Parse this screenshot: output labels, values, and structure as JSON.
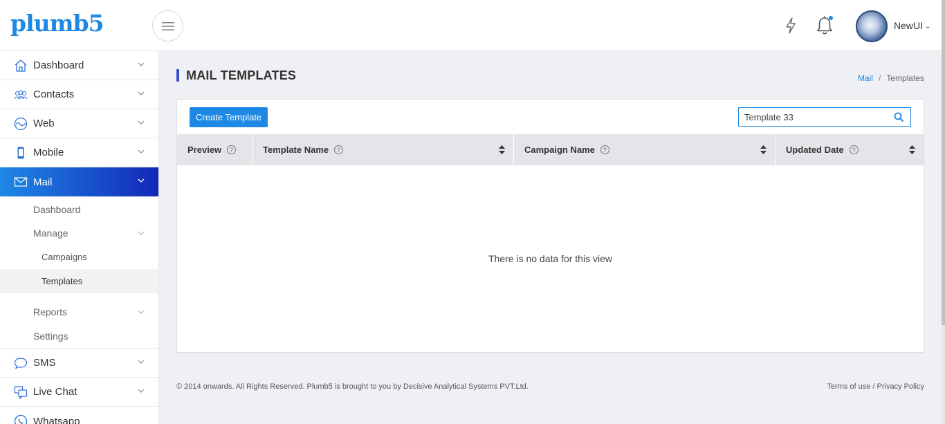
{
  "header": {
    "logo": "plumb5",
    "user_name": "NewUI",
    "menu_icon": "hamburger-icon",
    "bolt_icon": "lightning-icon",
    "bell_icon": "bell-icon",
    "accent": "#1e88e5"
  },
  "sidebar": {
    "items": [
      {
        "label": "Dashboard",
        "icon": "home-icon"
      },
      {
        "label": "Contacts",
        "icon": "contacts-icon"
      },
      {
        "label": "Web",
        "icon": "web-icon"
      },
      {
        "label": "Mobile",
        "icon": "mobile-icon"
      },
      {
        "label": "Mail",
        "icon": "mail-icon",
        "active": true
      },
      {
        "label": "SMS",
        "icon": "sms-icon"
      },
      {
        "label": "Live Chat",
        "icon": "live-chat-icon"
      },
      {
        "label": "Whatsapp",
        "icon": "whatsapp-icon"
      }
    ],
    "mail_sub": {
      "dashboard": "Dashboard",
      "manage": "Manage",
      "campaigns": "Campaigns",
      "templates": "Templates",
      "reports": "Reports",
      "settings": "Settings"
    }
  },
  "main": {
    "title": "MAIL TEMPLATES",
    "breadcrumb": {
      "link": "Mail",
      "sep": "/",
      "current": "Templates"
    },
    "create_button": "Create Template",
    "search": {
      "value": "Template 33",
      "placeholder": ""
    },
    "columns": [
      "Preview",
      "Template Name",
      "Campaign Name",
      "Updated Date"
    ],
    "empty_text": "There is no data for this view"
  },
  "footer": {
    "copyright": "© 2014 onwards. All Rights Reserved. Plumb5 is brought to you by Decisive Analytical Systems PVT.Ltd.",
    "terms": "Terms of use",
    "sep": "/",
    "privacy": "Privacy Policy"
  }
}
